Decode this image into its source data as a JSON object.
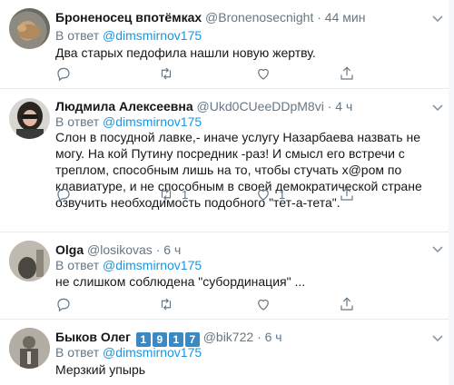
{
  "tweets": [
    {
      "name": "Броненосец впотёмках",
      "handle": "@Bronenosecnight",
      "time": "44 мин",
      "reply_prefix": "В ответ",
      "reply_to": "@dimsmirnov175",
      "text": "Два старых педофила нашли новую жертву.",
      "reply_count": "",
      "retweet_count": "",
      "like_count": ""
    },
    {
      "name": "Людмила Алексеевна",
      "handle": "@Ukd0CUeeDDpM8vi",
      "time": "4 ч",
      "reply_prefix": "В ответ",
      "reply_to": "@dimsmirnov175",
      "text": "Слон в посудной лавке,- иначе услугу Назарбаева назвать не могу. На кой Путину посредник -раз! И смысл его встречи с треплом, способным лишь на то, чтобы стучать х@ром по клавиатуре, и не способным в своей демократической стране озвучить необходимость подобного \"тет-а-тета\".",
      "reply_count": "",
      "retweet_count": "1",
      "like_count": "1"
    },
    {
      "name": "Olga",
      "handle": "@losikovas",
      "time": "6 ч",
      "reply_prefix": "В ответ",
      "reply_to": "@dimsmirnov175",
      "text": "не слишком соблюдена \"субординация\" ..."
    },
    {
      "name": "Быков Олег",
      "badges": [
        "1",
        "9",
        "1",
        "7"
      ],
      "handle": "@bik722",
      "time": "6 ч",
      "reply_prefix": "В ответ",
      "reply_to": "@dimsmirnov175",
      "text": "Мерзкий упырь"
    }
  ],
  "dot": "·",
  "colors": {
    "link": "#1b95e0",
    "muted": "#657786",
    "border": "#e6ecf0"
  }
}
